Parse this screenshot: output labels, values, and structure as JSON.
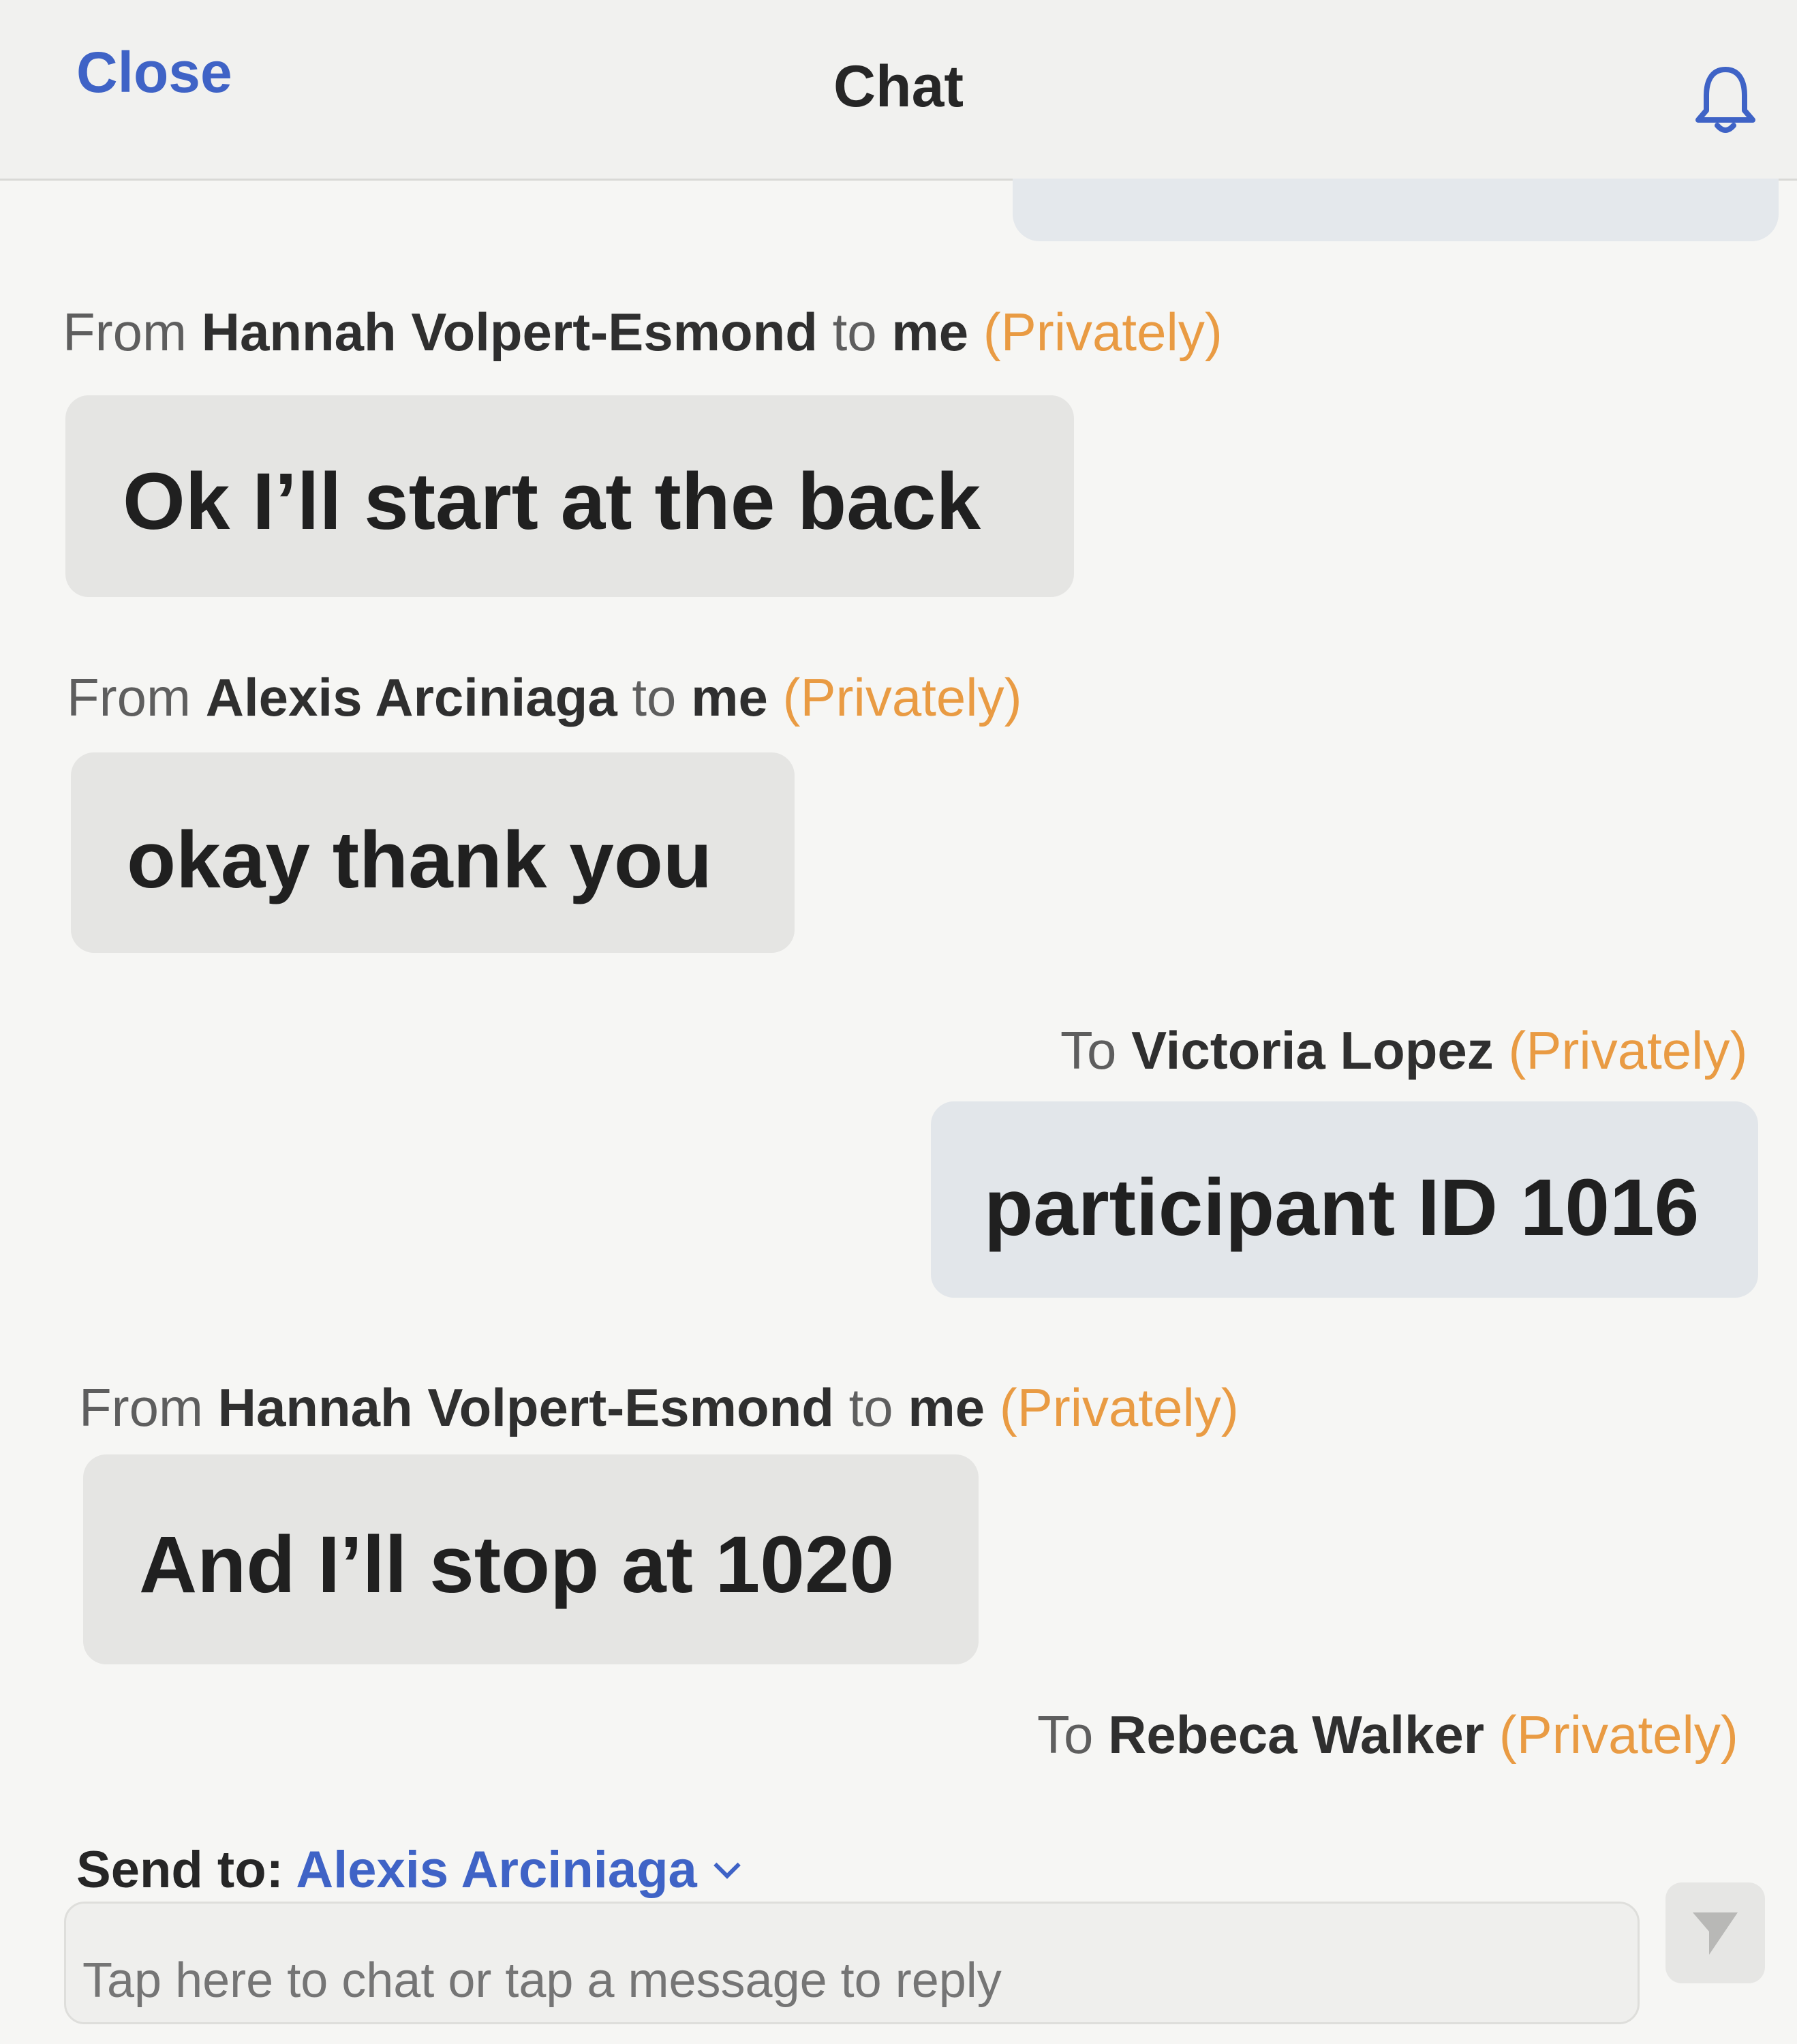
{
  "header": {
    "close_label": "Close",
    "title": "Chat"
  },
  "messages": [
    {
      "prefix": "From ",
      "name": "Hannah Volpert-Esmond",
      "connector": " to ",
      "recipient": "me",
      "privacy": " (Privately)",
      "text": "Ok I’ll start at the back"
    },
    {
      "prefix": "From ",
      "name": "Alexis Arciniaga",
      "connector": " to ",
      "recipient": "me",
      "privacy": " (Privately)",
      "text": "okay thank you"
    },
    {
      "prefix": "To ",
      "name": "Victoria Lopez",
      "privacy": " (Privately)",
      "text": "participant ID 1016"
    },
    {
      "prefix": "From ",
      "name": "Hannah Volpert-Esmond",
      "connector": " to ",
      "recipient": "me",
      "privacy": " (Privately)",
      "text": "And I’ll stop at 1020"
    },
    {
      "prefix": "To ",
      "name": "Rebeca Walker",
      "privacy": " (Privately)"
    }
  ],
  "composer": {
    "send_to_label": "Send to: ",
    "send_to_value": "Alexis Arciniaga",
    "placeholder": "Tap here to chat or tap a message to reply"
  },
  "colors": {
    "accent_blue": "#3f63c6",
    "privately_orange": "#e99b43",
    "incoming_bubble": "#e5e5e3",
    "outgoing_bubble": "#e2e6ea"
  }
}
